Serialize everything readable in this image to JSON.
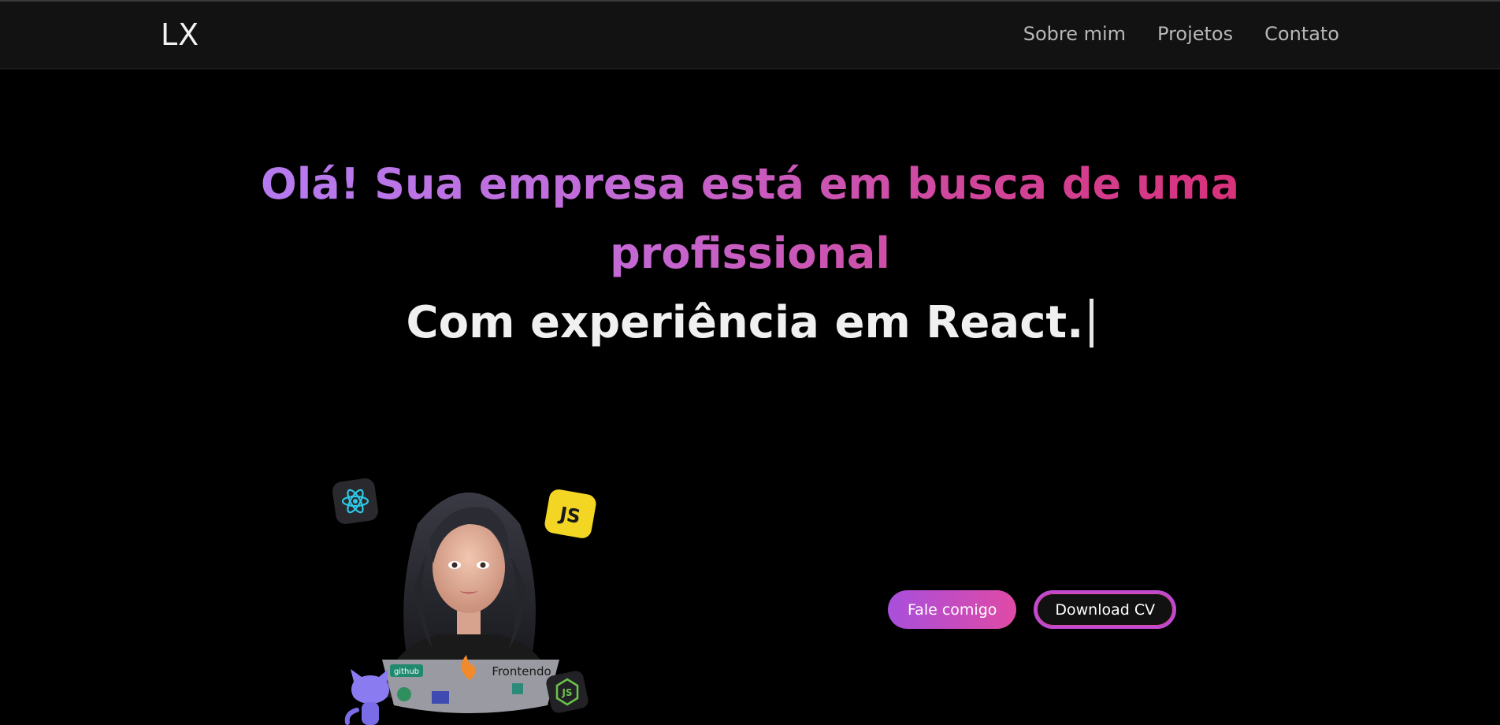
{
  "nav": {
    "logo": "LX",
    "links": [
      "Sobre mim",
      "Projetos",
      "Contato"
    ]
  },
  "hero": {
    "headline": "Olá! Sua empresa está em busca de uma profissional",
    "typed_text": "Com experiência em React."
  },
  "illustration": {
    "badges": {
      "js": "JS",
      "laptop_sticker_1": "github",
      "laptop_sticker_2": "Frontendo"
    }
  },
  "buttons": {
    "contact": "Fale comigo",
    "download": "Download CV"
  },
  "colors": {
    "gradient_start": "#b57bf0",
    "gradient_end": "#d8317a",
    "button_gradient_start": "#a84fdc",
    "button_gradient_end": "#e04aa5"
  }
}
